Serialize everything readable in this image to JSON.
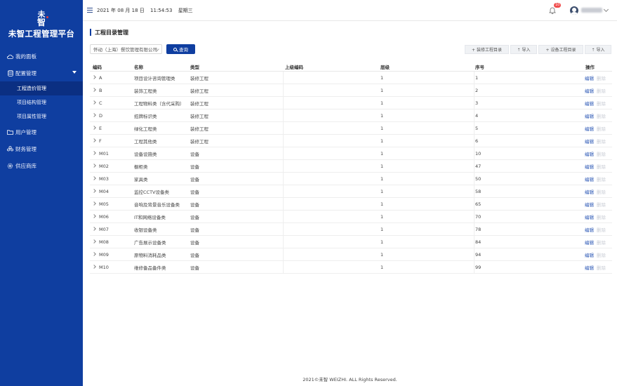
{
  "app": {
    "title": "未智工程管理平台"
  },
  "sidebar": {
    "items": [
      {
        "label": "我的面板",
        "icon": "cloud-icon"
      },
      {
        "label": "配置管理",
        "icon": "database-icon",
        "expanded": true,
        "children": [
          {
            "label": "工程造价管理",
            "active": true
          },
          {
            "label": "项目结构管理"
          },
          {
            "label": "项目属性管理"
          }
        ]
      },
      {
        "label": "用户管理",
        "icon": "folder-icon"
      },
      {
        "label": "财务管理",
        "icon": "users-icon"
      },
      {
        "label": "供应商库",
        "icon": "gear-icon"
      }
    ]
  },
  "topbar": {
    "date": "2021 年 08 月 18 日",
    "time": "11:54:53",
    "weekday": "星期三",
    "notification_count": "10"
  },
  "page": {
    "title": "工程目录管理",
    "filter_value": "怀动（上海）餐饮管理有限公司",
    "query_label": "查询",
    "actions": [
      {
        "label": "+ 装修工程目录"
      },
      {
        "label": "⇡ 导入"
      },
      {
        "label": "+ 设备工程目录"
      },
      {
        "label": "⇡ 导入"
      }
    ]
  },
  "table": {
    "headers": {
      "code": "编码",
      "name": "名称",
      "type": "类型",
      "parent": "上级编码",
      "level": "层级",
      "seq": "序号",
      "op": "操作"
    },
    "edit_label": "编辑",
    "delete_label": "删除",
    "rows": [
      {
        "code": "A",
        "name": "项目设计咨询管理类",
        "type": "装修工程",
        "parent": "",
        "level": "1",
        "seq": "1"
      },
      {
        "code": "B",
        "name": "装饰工程类",
        "type": "装修工程",
        "parent": "",
        "level": "1",
        "seq": "2"
      },
      {
        "code": "C",
        "name": "工程物料类（含代采购）",
        "type": "装修工程",
        "parent": "",
        "level": "1",
        "seq": "3"
      },
      {
        "code": "D",
        "name": "招牌标识类",
        "type": "装修工程",
        "parent": "",
        "level": "1",
        "seq": "4"
      },
      {
        "code": "E",
        "name": "绿化工程类",
        "type": "装修工程",
        "parent": "",
        "level": "1",
        "seq": "5"
      },
      {
        "code": "F",
        "name": "工程其他类",
        "type": "装修工程",
        "parent": "",
        "level": "1",
        "seq": "6"
      },
      {
        "code": "M01",
        "name": "设备设施类",
        "type": "设备",
        "parent": "",
        "level": "1",
        "seq": "10"
      },
      {
        "code": "M02",
        "name": "橱柜类",
        "type": "设备",
        "parent": "",
        "level": "1",
        "seq": "47"
      },
      {
        "code": "M03",
        "name": "家具类",
        "type": "设备",
        "parent": "",
        "level": "1",
        "seq": "50"
      },
      {
        "code": "M04",
        "name": "监控CCTV设备类",
        "type": "设备",
        "parent": "",
        "level": "1",
        "seq": "58"
      },
      {
        "code": "M05",
        "name": "音响及背景音乐设备类",
        "type": "设备",
        "parent": "",
        "level": "1",
        "seq": "65"
      },
      {
        "code": "M06",
        "name": "IT和网络设备类",
        "type": "设备",
        "parent": "",
        "level": "1",
        "seq": "70"
      },
      {
        "code": "M07",
        "name": "收银设备类",
        "type": "设备",
        "parent": "",
        "level": "1",
        "seq": "78"
      },
      {
        "code": "M08",
        "name": "广告展示设备类",
        "type": "设备",
        "parent": "",
        "level": "1",
        "seq": "84"
      },
      {
        "code": "M09",
        "name": "原物料消耗品类",
        "type": "设备",
        "parent": "",
        "level": "1",
        "seq": "94"
      },
      {
        "code": "M10",
        "name": "维修备品备件类",
        "type": "设备",
        "parent": "",
        "level": "1",
        "seq": "99"
      }
    ]
  },
  "footer": {
    "text": "2021©未智 WEIZHI. ALL Rights Reserved."
  },
  "colors": {
    "sidebar_bg": "#0f3ea0",
    "accent": "#0f3ea0",
    "badge": "#f04e4e",
    "edit_link": "#2a56b5"
  }
}
